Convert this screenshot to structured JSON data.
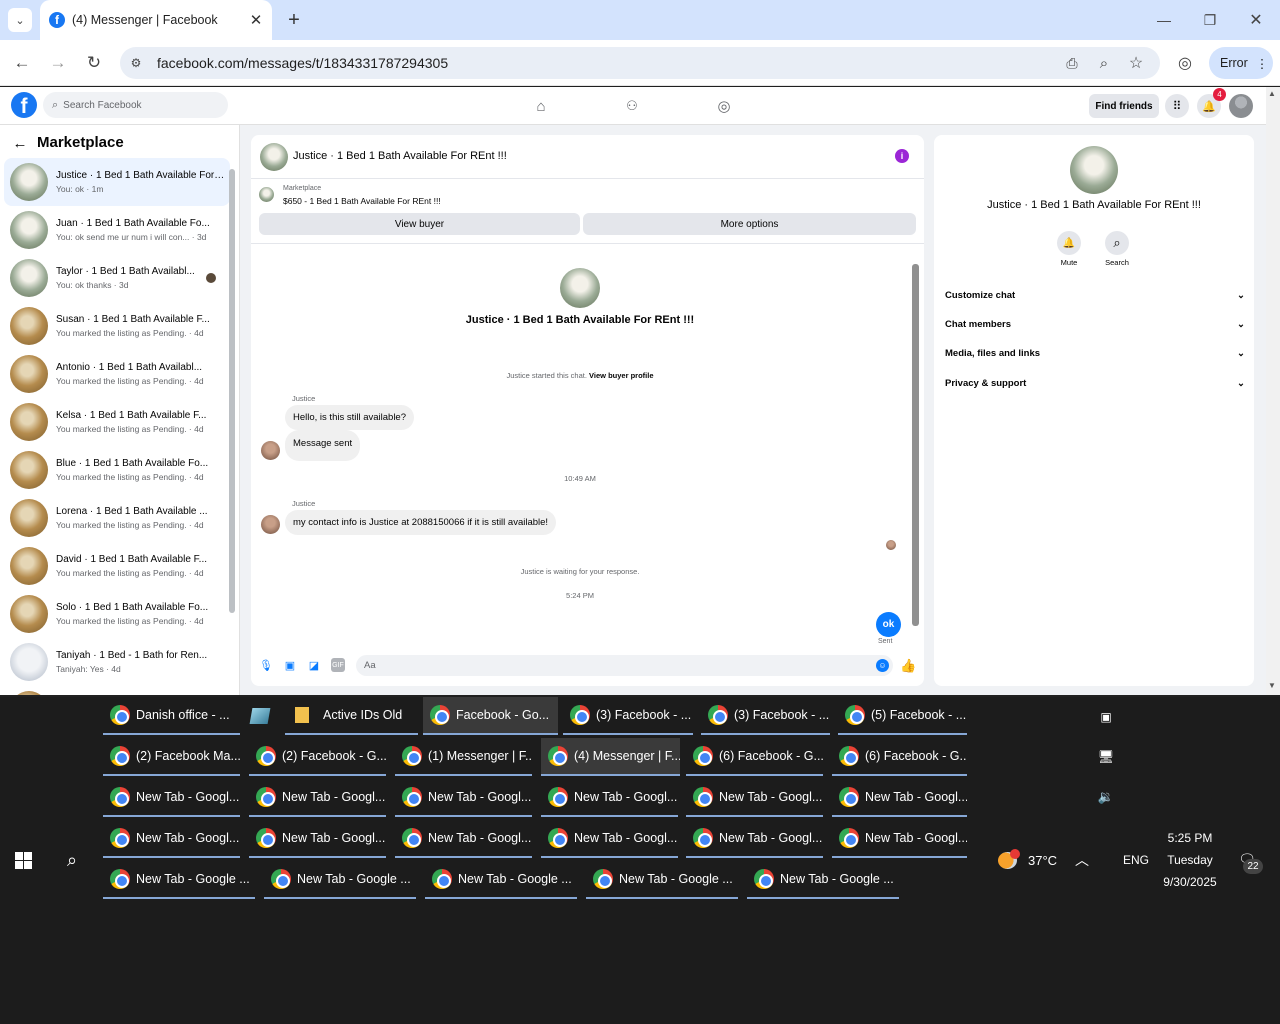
{
  "browser": {
    "tab_title": "(4) Messenger | Facebook",
    "url": "facebook.com/messages/t/1834331787294305",
    "profile_label": "Error"
  },
  "fb": {
    "search_placeholder": "Search Facebook",
    "find_friends": "Find friends",
    "notif_count": "4"
  },
  "left": {
    "title": "Marketplace",
    "rows": [
      {
        "name": "Justice · 1 Bed 1 Bath Available For REnt !!!",
        "sub": "You: ok · 1m"
      },
      {
        "name": "Juan · 1 Bed 1 Bath Available Fo...",
        "sub": "You: ok send me ur num i will con... · 3d"
      },
      {
        "name": "Taylor · 1 Bed 1 Bath Availabl...",
        "sub": "You: ok thanks · 3d"
      },
      {
        "name": "Susan · 1 Bed 1 Bath Available F...",
        "sub": "You marked the listing as Pending. · 4d"
      },
      {
        "name": "Antonio · 1 Bed 1 Bath Availabl...",
        "sub": "You marked the listing as Pending. · 4d"
      },
      {
        "name": "Kelsa · 1 Bed 1 Bath Available F...",
        "sub": "You marked the listing as Pending. · 4d"
      },
      {
        "name": "Blue · 1 Bed 1 Bath Available Fo...",
        "sub": "You marked the listing as Pending. · 4d"
      },
      {
        "name": "Lorena · 1 Bed 1 Bath Available ...",
        "sub": "You marked the listing as Pending. · 4d"
      },
      {
        "name": "David · 1 Bed 1 Bath Available F...",
        "sub": "You marked the listing as Pending. · 4d"
      },
      {
        "name": "Solo · 1 Bed 1 Bath Available Fo...",
        "sub": "You marked the listing as Pending. · 4d"
      },
      {
        "name": "Taniyah · 1 Bed - 1 Bath for Ren...",
        "sub": "Taniyah: Yes · 4d"
      }
    ]
  },
  "chat": {
    "title": "Justice · 1 Bed 1 Bath Available For REnt !!!",
    "marketplace_label": "Marketplace",
    "listing": "$650 - 1 Bed 1 Bath Available For REnt !!!",
    "view_buyer": "View buyer",
    "more_options": "More options",
    "header_name": "Justice · 1 Bed 1 Bath Available For REnt !!!",
    "started_text": "Justice started this chat.",
    "view_profile": "View buyer profile",
    "sender1": "Justice",
    "msg1": "Hello, is this still available?",
    "msg2": "Message sent",
    "time1": "10:49 AM",
    "sender2": "Justice",
    "msg3": "my contact info is Justice at 2088150066 if it is still available!",
    "waiting": "Justice is waiting for your response.",
    "time2": "5:24 PM",
    "my_msg": "ok",
    "sent": "Sent",
    "composer_placeholder": "Aa"
  },
  "info": {
    "name": "Justice · 1 Bed 1 Bath Available For REnt !!!",
    "mute": "Mute",
    "search": "Search",
    "sections": [
      "Customize chat",
      "Chat members",
      "Media, files and links",
      "Privacy & support"
    ]
  },
  "taskbar": {
    "rows": [
      [
        "Danish office - ...",
        "",
        "Active IDs Old",
        "Facebook - Go...",
        "(3) Facebook - ...",
        "(3) Facebook - ...",
        "(5) Facebook - ..."
      ],
      [
        "(2) Facebook Ma...",
        "(2) Facebook - G...",
        "(1) Messenger | F...",
        "(4) Messenger | F...",
        "(6) Facebook - G...",
        "(6) Facebook - G..."
      ],
      [
        "New Tab - Googl...",
        "New Tab - Googl...",
        "New Tab - Googl...",
        "New Tab - Googl...",
        "New Tab - Googl...",
        "New Tab - Googl..."
      ],
      [
        "New Tab - Googl...",
        "New Tab - Googl...",
        "New Tab - Googl...",
        "New Tab - Googl...",
        "New Tab - Googl...",
        "New Tab - Googl..."
      ],
      [
        "New Tab - Google ...",
        "New Tab - Google ...",
        "New Tab - Google ...",
        "New Tab - Google ...",
        "New Tab - Google ..."
      ]
    ],
    "temp": "37°C",
    "lang": "ENG",
    "time": "5:25 PM",
    "day": "Tuesday",
    "date": "9/30/2025",
    "notif": "22"
  }
}
